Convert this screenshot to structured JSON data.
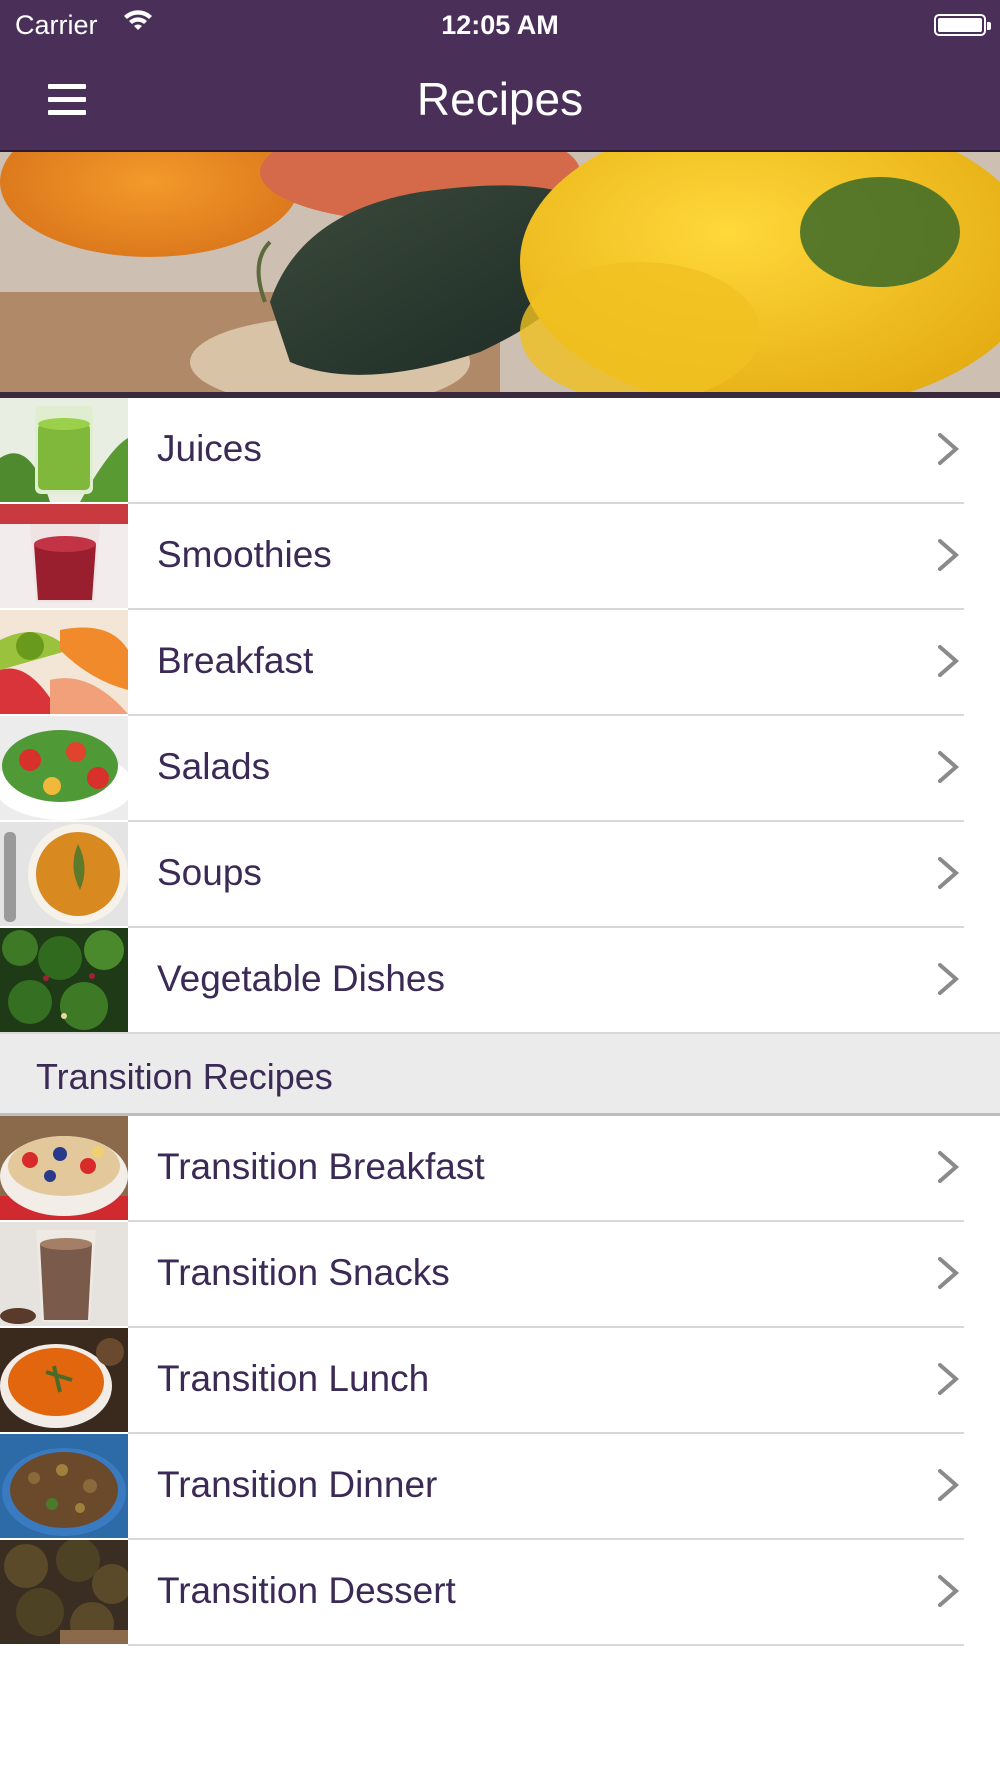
{
  "status_bar": {
    "carrier": "Carrier",
    "time": "12:05 AM"
  },
  "nav": {
    "title": "Recipes",
    "menu_icon": "hamburger-menu-icon"
  },
  "colors": {
    "nav_background": "#4a3059",
    "text_primary": "#3b2a55",
    "section_background": "#ebebeb"
  },
  "categories": [
    {
      "label": "Juices",
      "thumb": "green-juice-glass"
    },
    {
      "label": "Smoothies",
      "thumb": "red-smoothie-glass"
    },
    {
      "label": "Breakfast",
      "thumb": "fruit-plate"
    },
    {
      "label": "Salads",
      "thumb": "tomato-salad"
    },
    {
      "label": "Soups",
      "thumb": "orange-soup-bowl"
    },
    {
      "label": "Vegetable Dishes",
      "thumb": "kale-dish"
    }
  ],
  "section": {
    "title": "Transition Recipes"
  },
  "transition": [
    {
      "label": "Transition Breakfast",
      "thumb": "oatmeal-berries-bowl"
    },
    {
      "label": "Transition Snacks",
      "thumb": "chocolate-shake-glass"
    },
    {
      "label": "Transition Lunch",
      "thumb": "pumpkin-soup-bowl"
    },
    {
      "label": "Transition Dinner",
      "thumb": "lentil-bowl"
    },
    {
      "label": "Transition Dessert",
      "thumb": "cookies"
    }
  ]
}
